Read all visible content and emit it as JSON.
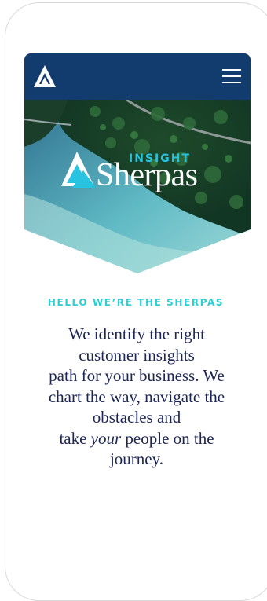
{
  "header": {
    "menu_icon": "hamburger-menu-icon",
    "logo_icon": "mountain-logo-icon",
    "background_color": "#123b6e"
  },
  "hero": {
    "brand_small": "INSIGHT",
    "brand_large": "Sherpas",
    "image": "aerial view of forest and lake"
  },
  "intro": {
    "tagline": "HELLO WE’RE THE SHERPAS",
    "lines": [
      "We identify the right",
      "customer insights",
      "path for your business. We",
      "chart the way, navigate the",
      "obstacles and"
    ],
    "last_line_before": "take ",
    "last_line_em": "your",
    "last_line_after": " people on the",
    "final_line": "journey."
  },
  "colors": {
    "accent": "#27c3e0",
    "text": "#1c2553",
    "tagline": "#2ad0d6"
  }
}
